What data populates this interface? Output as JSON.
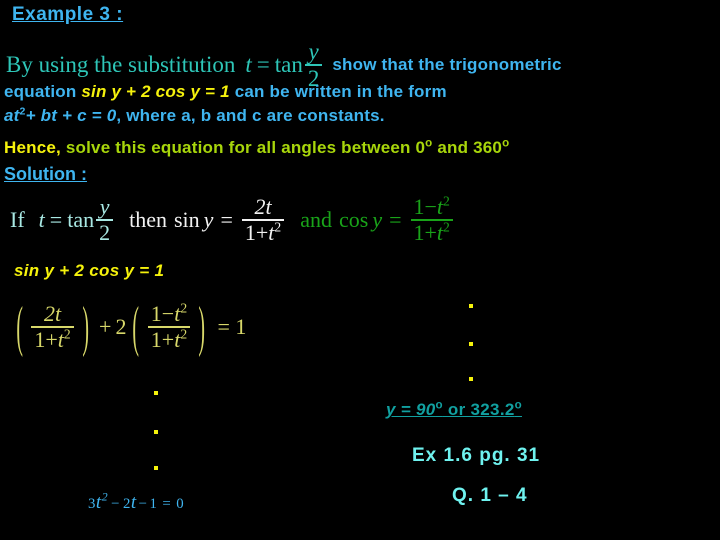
{
  "slide": {
    "background_color": "#000000",
    "title": "Example 3 :"
  },
  "problem": {
    "intro_serif": "By using the substitution",
    "substitution": {
      "lhs": "t",
      "eq": "=",
      "fn": "tan",
      "num": "y",
      "den": "2"
    },
    "intro_tail": "show that the trigonometric",
    "line3": {
      "part1": "equation",
      "highlight": "sin y + 2 cos y = 1",
      "part2": "can be written in the form"
    },
    "line4": {
      "form_a": "at",
      "form_sq": "2",
      "form_rest": "+ bt + c = 0",
      "tail": ", where a, b and c are constants."
    },
    "hence": "Hence,",
    "hence_rest": "solve this equation for all angles between 0",
    "hence_deg1": "o",
    "hence_mid": " and 360",
    "hence_deg2": "o"
  },
  "solution": {
    "label": "Solution :",
    "identity": {
      "if_text": "If",
      "t_sym": "t",
      "eq1": "=",
      "tan": "tan",
      "tan_num": "y",
      "tan_den": "2",
      "then": "then",
      "sin": "sin",
      "sin_arg": "y",
      "eq2": "=",
      "sin_num": "2t",
      "sin_den_a": "1+",
      "sin_den_t": "t",
      "sin_den_sq": "2",
      "and": "and",
      "cos": "cos",
      "cos_arg": "y",
      "eq3": "=",
      "cos_num_a": "1−",
      "cos_num_t": "t",
      "cos_num_sq": "2",
      "cos_den_a": "1+",
      "cos_den_t": "t",
      "cos_den_sq": "2"
    },
    "equation_yellow": "sin y + 2 cos y = 1",
    "big_equation": {
      "open1": "(",
      "num1": "2t",
      "den1_a": "1+",
      "den1_t": "t",
      "den1_sq": "2",
      "close1": ")",
      "plus": "+",
      "two": "2",
      "open2": "(",
      "num2_a": "1−",
      "num2_t": "t",
      "num2_sq": "2",
      "den2_a": "1+",
      "den2_t": "t",
      "den2_sq": "2",
      "close2": ")",
      "equals": "= 1"
    },
    "final_equation": {
      "c3": "3",
      "t1": "t",
      "sq": "2",
      "minus1": "−",
      "c2": "2",
      "t2": "t",
      "minus2": "−",
      "c1": "1",
      "eq": "=",
      "zero": "0"
    }
  },
  "answers": {
    "result": "y = 90",
    "result_deg1": "o",
    "result_mid": " or 323.2",
    "result_deg2": "o",
    "exercise": "Ex 1.6  pg. 31",
    "questions": "Q. 1 – 4"
  },
  "colors": {
    "title": "#3fb5f0",
    "blue_text": "#3fb5f0",
    "yellow": "#f5f20c",
    "green": "#19a319",
    "lime": "#a8d60b",
    "teal_serif": "#2ec6b8",
    "white": "#f2f2f2",
    "pale_yellow": "#d8d86a",
    "cyan_bright": "#6ff2ef",
    "teal_answer": "#11a0a0"
  }
}
